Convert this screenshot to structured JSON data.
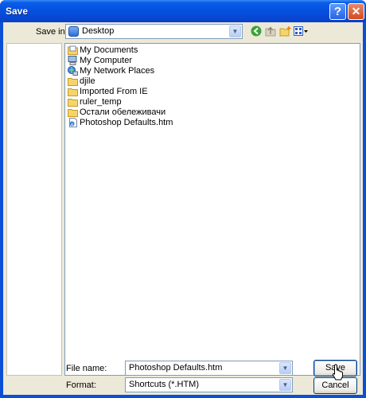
{
  "window": {
    "title": "Save"
  },
  "titlebar": {
    "help_label": "?",
    "close_label": "✕"
  },
  "save_in": {
    "label": "Save in:",
    "value": "Desktop"
  },
  "toolbar_icons": [
    "back-icon",
    "up-folder-icon",
    "new-folder-icon",
    "views-menu-icon"
  ],
  "files": [
    {
      "name": "My Documents",
      "icon": "my-documents-icon"
    },
    {
      "name": "My Computer",
      "icon": "my-computer-icon"
    },
    {
      "name": "My Network Places",
      "icon": "network-places-icon"
    },
    {
      "name": "djile",
      "icon": "folder-icon"
    },
    {
      "name": "Imported From IE",
      "icon": "folder-icon"
    },
    {
      "name": "ruler_temp",
      "icon": "folder-icon"
    },
    {
      "name": "Остали обележивачи",
      "icon": "folder-icon"
    },
    {
      "name": "Photoshop Defaults.htm",
      "icon": "html-file-icon"
    }
  ],
  "file_name": {
    "label": "File name:",
    "value": "Photoshop Defaults.htm"
  },
  "format": {
    "label": "Format:",
    "value": "Shortcuts (*.HTM)"
  },
  "buttons": {
    "save": "Save",
    "cancel": "Cancel"
  },
  "colors": {
    "titlebar": "#0551e0",
    "client": "#ece9d8",
    "border": "#7f9db9"
  }
}
